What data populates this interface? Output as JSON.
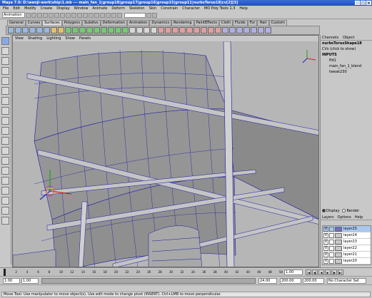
{
  "window": {
    "title": "Maya 7.0: D:\\wenji-work\\ship\\1.mb  ---  main_fan_1|group18|group17|group16|group15|group11|nurbsTorus18|cv[2][3]"
  },
  "menubar": [
    "File",
    "Edit",
    "Modify",
    "Create",
    "Display",
    "Window",
    "Animate",
    "Deform",
    "Skeleton",
    "Skin",
    "Constrain",
    "Character",
    "MO Poly Tools 1.3",
    "Help"
  ],
  "statusline": {
    "mode": "Animation"
  },
  "shelf_tabs": [
    "General",
    "Curves",
    "Surfaces",
    "Polygons",
    "Subdivs",
    "Deformation",
    "Animation",
    "Dynamics",
    "Rendering",
    "PaintEffects",
    "Cloth",
    "Fluids",
    "Fur",
    "Hair",
    "Custom"
  ],
  "shelf_active": "Surfaces",
  "viewport": {
    "menu": [
      "View",
      "Shading",
      "Lighting",
      "Show",
      "Panels"
    ]
  },
  "channel_box": {
    "tabs": [
      "Channels",
      "Object"
    ],
    "object": "nurbsTorusShape18",
    "cvs": "CVs (click to show)",
    "inputs_header": "INPUTS",
    "inputs": [
      "ffd1",
      "main_fan_1_blend",
      "tweak230"
    ]
  },
  "layer_editor": {
    "display": "Display",
    "render": "Render",
    "menu": [
      "Layers",
      "Options",
      "Help"
    ],
    "layers": [
      {
        "name": "layer25",
        "selected": true
      },
      {
        "name": "layer24",
        "selected": false
      },
      {
        "name": "layer23",
        "selected": false
      },
      {
        "name": "layer22",
        "selected": false
      },
      {
        "name": "layer21",
        "selected": false
      },
      {
        "name": "layer20",
        "selected": false
      }
    ]
  },
  "time": {
    "current_frame": "1.00",
    "ticks": [
      "1",
      "2",
      "4",
      "6",
      "8",
      "10",
      "12",
      "14",
      "16",
      "18",
      "20",
      "22",
      "24",
      "26",
      "28",
      "30",
      "32",
      "34",
      "36",
      "38",
      "40",
      "42",
      "44",
      "46",
      "48",
      "50"
    ],
    "range_start": "1.00",
    "range_start2": "1.00",
    "range_end": "24.00",
    "anim_end": "200.00",
    "anim_end2": "200.00",
    "character_set": "No Character Set"
  },
  "help_line": "Move Tool: Use manipulator to move object(s). Use edit mode to change pivot (INSERT). Ctrl+LMB to move perpendicular.",
  "colors": {
    "wire": "#1a1aa8",
    "accent": "#2050b8"
  }
}
